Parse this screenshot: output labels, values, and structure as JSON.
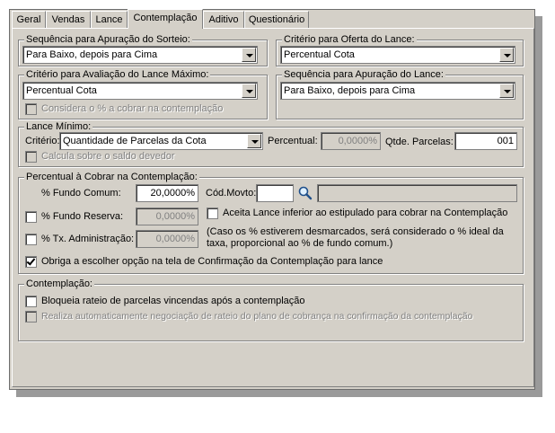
{
  "tabs": [
    {
      "label": "Geral"
    },
    {
      "label": "Vendas"
    },
    {
      "label": "Lance"
    },
    {
      "label": "Contemplação"
    },
    {
      "label": "Aditivo"
    },
    {
      "label": "Questionário"
    }
  ],
  "active_tab": "Contemplação",
  "sorteio": {
    "legend": "Sequência para Apuração do Sorteio:",
    "value": "Para Baixo, depois para Cima"
  },
  "oferta": {
    "legend": "Critério para Oferta do Lance:",
    "value": "Percentual Cota"
  },
  "avaliacao": {
    "legend": "Critério para Avaliação do Lance Máximo:",
    "value": "Percentual Cota",
    "considera_label": "Considera o % a cobrar na contemplação"
  },
  "apuracao_lance": {
    "legend": "Sequência para Apuração do Lance:",
    "value": "Para Baixo, depois para Cima"
  },
  "lance_minimo": {
    "legend": "Lance Mínimo:",
    "criterio_label": "Critério:",
    "criterio_value": "Quantidade de Parcelas da Cota",
    "percentual_label": "Percentual:",
    "percentual_value": "0,0000%",
    "qtde_label": "Qtde. Parcelas:",
    "qtde_value": "001",
    "calcula_label": "Calcula sobre o saldo devedor"
  },
  "percentual_cobrar": {
    "legend": "Percentual à Cobrar na Contemplação:",
    "fundo_comum_label": "% Fundo Comum:",
    "fundo_comum_value": "20,0000%",
    "cod_movto_label": "Cód.Movto:",
    "cod_movto_value": "",
    "fundo_reserva_label": "% Fundo Reserva:",
    "fundo_reserva_value": "0,0000%",
    "aceita_label": "Aceita Lance inferior ao estipulado para cobrar na Contemplação",
    "tx_adm_label": "% Tx. Administração:",
    "tx_adm_value": "0,0000%",
    "note_line1": "(Caso os % estiverem desmarcados, será considerado o % ideal da",
    "note_line2": "taxa, proporcional ao % de fundo comum.)",
    "obriga_label": "Obriga a escolher opção na tela de Confirmação da Contemplação para lance"
  },
  "contemplacao": {
    "legend": "Contemplação:",
    "bloqueia_label": "Bloqueia rateio de parcelas vincendas após a contemplação",
    "realiza_label": "Realiza automaticamente negociação de rateio do plano de cobrança na confirmação da contemplação"
  }
}
